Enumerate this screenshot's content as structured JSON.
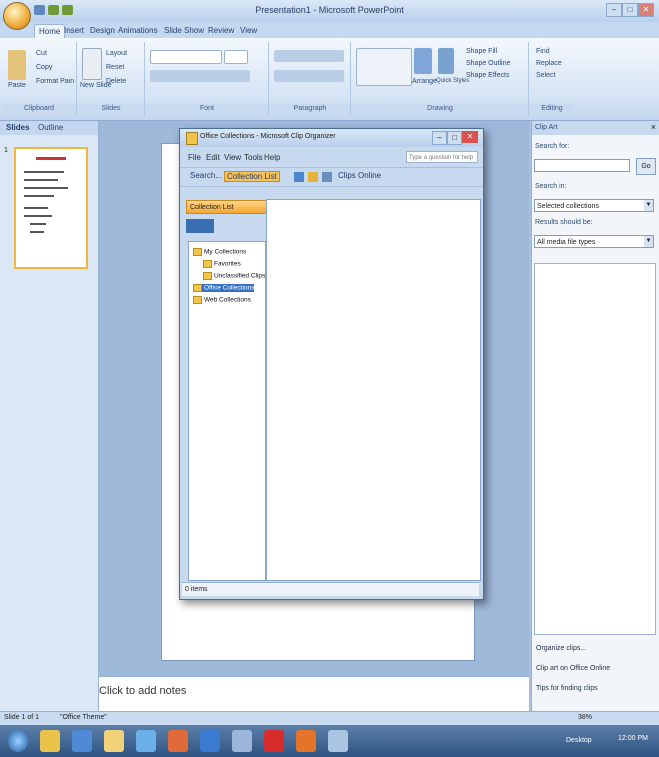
{
  "window": {
    "title": "Presentation1 - Microsoft PowerPoint",
    "controls": [
      "–",
      "□",
      "✕"
    ]
  },
  "ribbon": {
    "tabs": [
      "Home",
      "Insert",
      "Design",
      "Animations",
      "Slide Show",
      "Review",
      "View"
    ],
    "groups": [
      "Clipboard",
      "Slides",
      "Font",
      "Paragraph",
      "Drawing",
      "Editing"
    ],
    "clipboard": {
      "paste": "Paste",
      "cut": "Cut",
      "copy": "Copy",
      "format_painter": "Format Painter"
    },
    "slides": {
      "new_slide": "New Slide",
      "layout": "Layout",
      "reset": "Reset",
      "delete": "Delete"
    },
    "drawing": {
      "arrange": "Arrange",
      "quick_styles": "Quick Styles",
      "shape_fill": "Shape Fill",
      "shape_outline": "Shape Outline",
      "shape_effects": "Shape Effects"
    },
    "editing": {
      "find": "Find",
      "replace": "Replace",
      "select": "Select"
    }
  },
  "slides_pane": {
    "tabs": [
      "Slides",
      "Outline"
    ],
    "thumb_number": "1"
  },
  "notes": {
    "placeholder": "Click to add notes"
  },
  "task_pane": {
    "title": "Clip Art",
    "search_for_label": "Search for:",
    "go_label": "Go",
    "search_in_label": "Search in:",
    "search_in_value": "Selected collections",
    "results_label": "Results should be:",
    "results_value": "All media file types",
    "links": [
      "Organize clips...",
      "Clip art on Office Online",
      "Tips for finding clips"
    ]
  },
  "statusbar": {
    "slide": "Slide 1 of 1",
    "theme": "\"Office Theme\"",
    "zoom": "38%"
  },
  "clip_dialog": {
    "title": "Office Collections - Microsoft Clip Organizer",
    "menus": [
      "File",
      "Edit",
      "View",
      "Tools",
      "Help"
    ],
    "search_placeholder": "Type a question for help",
    "toolbar": {
      "search": "Search...",
      "collection_list": "Collection List",
      "clips_online": "Clips Online"
    },
    "collection_header": "Collection List",
    "tree": [
      {
        "label": "My Collections",
        "selected": false
      },
      {
        "label": "Favorites",
        "selected": false
      },
      {
        "label": "Unclassified Clips",
        "selected": false
      },
      {
        "label": "Office Collections",
        "selected": true
      },
      {
        "label": "Web Collections",
        "selected": false
      }
    ],
    "status": "0 items"
  },
  "taskbar": {
    "lang": "Desktop",
    "time": "12:00 PM"
  }
}
